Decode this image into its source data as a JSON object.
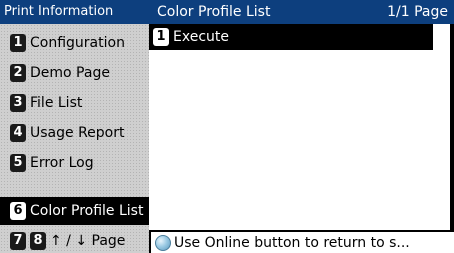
{
  "left_panel": {
    "header": "Print Information",
    "items": [
      {
        "num": "1",
        "label": "Configuration"
      },
      {
        "num": "2",
        "label": "Demo Page"
      },
      {
        "num": "3",
        "label": "File List"
      },
      {
        "num": "4",
        "label": "Usage Report"
      },
      {
        "num": "5",
        "label": "Error Log"
      },
      {
        "num": "6",
        "label": "Color Profile List",
        "selected": true
      }
    ],
    "nav": {
      "num_prev": "7",
      "num_next": "8",
      "label": "↑ / ↓ Page"
    }
  },
  "right_panel": {
    "title": "Color Profile List",
    "page_indicator": "1/1 Page",
    "items": [
      {
        "num": "1",
        "label": "Execute"
      }
    ]
  },
  "status_bar": {
    "icon": "online-button-icon",
    "text": "Use Online button to return to s..."
  },
  "colors": {
    "header_bg": "#0d3f7e",
    "selected_bg": "#000000",
    "panel_bg": "#cfcfcf"
  }
}
